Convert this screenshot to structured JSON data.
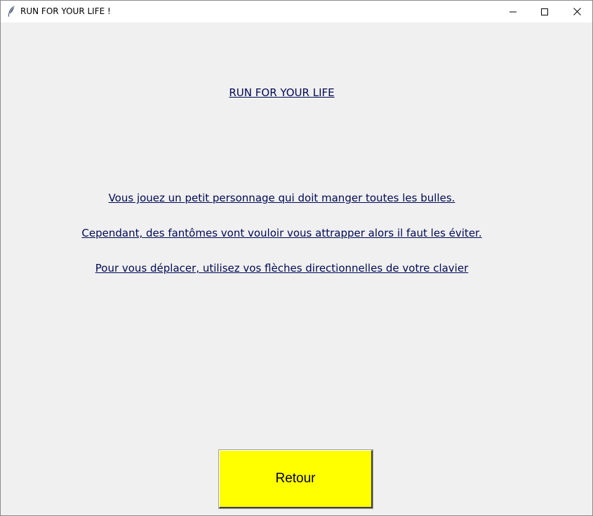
{
  "window": {
    "title": "RUN FOR YOUR LIFE !",
    "icon": "feather-icon",
    "controls": [
      "minimize-icon",
      "maximize-icon",
      "close-icon"
    ]
  },
  "content": {
    "heading": "RUN FOR YOUR LIFE",
    "paragraphs": [
      "Vous jouez un petit personnage qui doit manger toutes les bulles.",
      "Cependant, des fantômes vont vouloir vous attrapper alors il faut les éviter.",
      "Pour vous déplacer, utilisez vos flèches directionnelles de votre clavier"
    ],
    "back_button": "Retour"
  },
  "colors": {
    "background": "#f0f0f0",
    "text": "#000a55",
    "button": "#ffff00",
    "titlebar": "#ffffff"
  }
}
